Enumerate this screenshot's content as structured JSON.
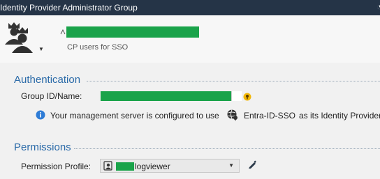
{
  "window": {
    "title": "Identity Provider Administrator Group"
  },
  "header": {
    "description": "CP users for SSO",
    "avatar_icon": "admin-group-icon"
  },
  "authentication": {
    "section_title": "Authentication",
    "group_label": "Group ID/Name:",
    "info_icon": "info-icon",
    "info_text": "Your management server is configured to use",
    "provider_icon": "globe-key-icon",
    "provider_name": "Entra-ID-SSO",
    "provider_suffix": "as its Identity Provider"
  },
  "permissions": {
    "section_title": "Permissions",
    "profile_label": "Permission Profile:",
    "profile_value": "logviewer",
    "edit_icon": "pencil-icon"
  },
  "colors": {
    "titlebar": "#253447",
    "section_title": "#2a6aa8",
    "redaction": "#1aa34a"
  }
}
